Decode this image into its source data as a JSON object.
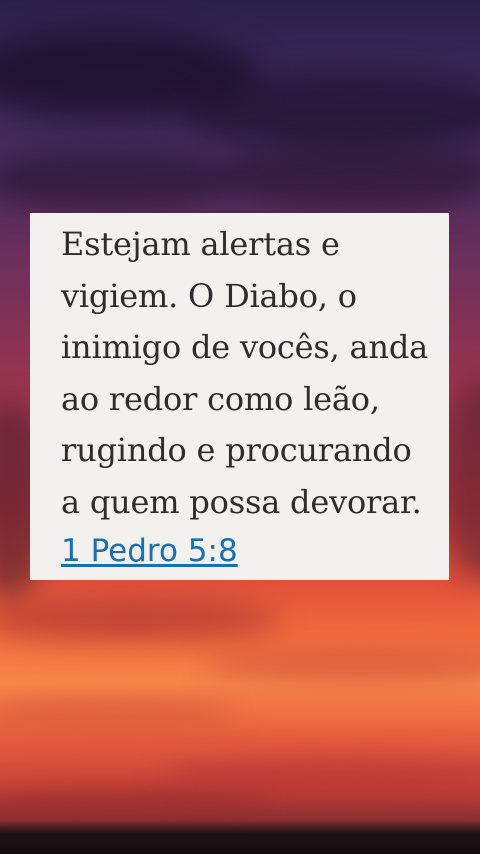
{
  "verse": {
    "text": "Estejam alertas e vigiem. O Diabo, o inimigo de vocês, anda ao redor como leão, rugindo e procurando a quem possa devorar.",
    "reference": "1 Pedro 5:8"
  },
  "colors": {
    "card_background": "#f3f1ee",
    "verse_text": "#2d2d2d",
    "reference_link": "#1a6fb3"
  }
}
